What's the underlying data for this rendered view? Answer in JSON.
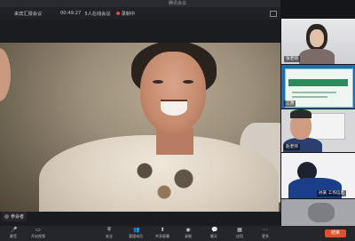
{
  "window": {
    "title": "腾讯会议"
  },
  "info": {
    "meeting_name": "来宾汇报会议",
    "time": "00:49:27",
    "participants": "5人在线会议",
    "recording": "录制中"
  },
  "main": {
    "speaker": "参会者"
  },
  "tiles": [
    {
      "label": "张老师"
    },
    {
      "label": "江滪"
    },
    {
      "label": "赵老师"
    },
    {
      "label": "孙某 工作信息"
    },
    {
      "label": ""
    }
  ],
  "toolbar": {
    "items": [
      {
        "icon": "mic-icon",
        "label": "静音"
      },
      {
        "icon": "video-icon",
        "label": "开启视频"
      },
      {
        "icon": "security-icon",
        "label": "安全"
      },
      {
        "icon": "members-icon",
        "label": "管理成员"
      },
      {
        "icon": "share-icon",
        "label": "共享屏幕"
      },
      {
        "icon": "record-icon",
        "label": "录制"
      },
      {
        "icon": "chat-icon",
        "label": "聊天"
      },
      {
        "icon": "apps-icon",
        "label": "应用"
      },
      {
        "icon": "more-icon",
        "label": "更多"
      }
    ],
    "end_label": "结束"
  },
  "colors": {
    "end_button": "#e0502d",
    "record_dot": "#e24a3b",
    "sidebar_accent": "#1f6fb0"
  }
}
